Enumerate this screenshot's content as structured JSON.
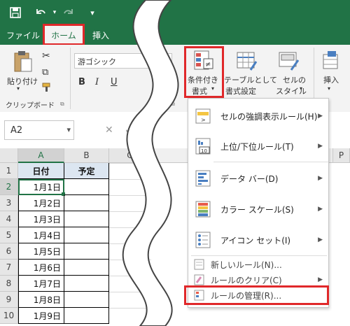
{
  "tabs": {
    "file": "ファイル",
    "home": "ホーム",
    "insert": "挿入"
  },
  "ribbon": {
    "paste": "貼り付け",
    "clipboard_group": "クリップボード",
    "font_name": "游ゴシック",
    "bold": "B",
    "italic": "I",
    "underline": "U",
    "cond_format_line1": "条件付き",
    "cond_format_line2": "書式",
    "table_format_line1": "テーブルとして",
    "table_format_line2": "書式設定",
    "cell_style_line1": "セルの",
    "cell_style_line2": "スタイル",
    "insert": "挿入"
  },
  "namebox": "A2",
  "fx": "fx",
  "columns": [
    "A",
    "B",
    "C",
    "P"
  ],
  "rows": [
    "1",
    "2",
    "3",
    "4",
    "5",
    "6",
    "7",
    "8",
    "9",
    "10"
  ],
  "table": {
    "header_a": "日付",
    "header_b": "予定",
    "dates": [
      "1月1日",
      "1月2日",
      "1月3日",
      "1月4日",
      "1月5日",
      "1月6日",
      "1月7日",
      "1月8日",
      "1月9日"
    ]
  },
  "menu": {
    "highlight_rules": "セルの強調表示ルール(H)",
    "top_bottom_rules": "上位/下位ルール(T)",
    "data_bars": "データ バー(D)",
    "color_scales": "カラー スケール(S)",
    "icon_sets": "アイコン セット(I)",
    "new_rule": "新しいルール(N)...",
    "clear_rules": "ルールのクリア(C)",
    "manage_rules": "ルールの管理(R)..."
  },
  "icon_labels": {
    "ten": "10",
    "gt": ">"
  },
  "colors": {
    "excel_green": "#217346",
    "highlight_red": "#e0282a"
  }
}
